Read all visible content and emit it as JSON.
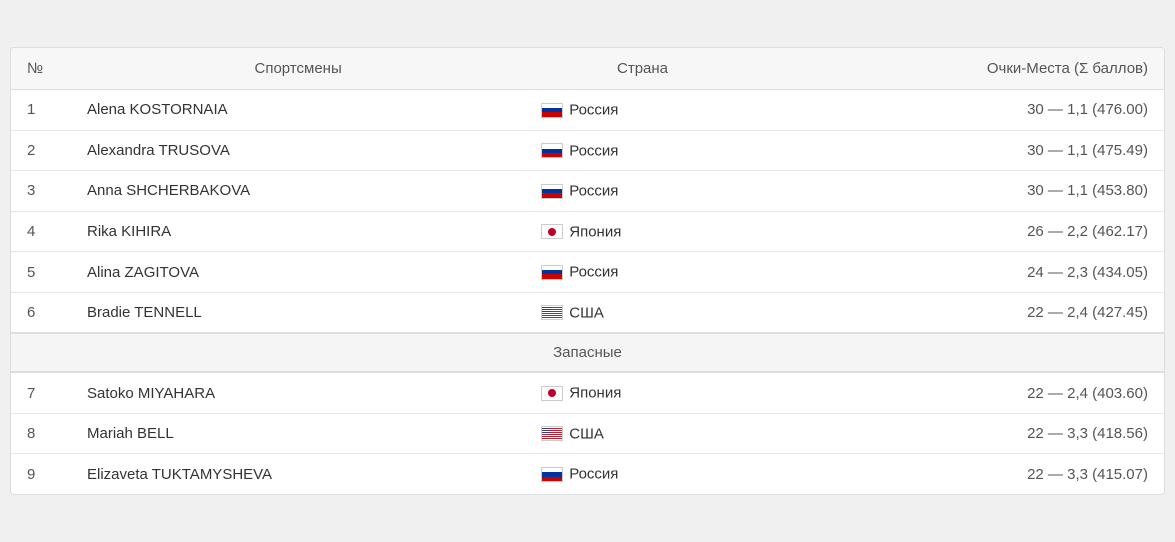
{
  "header": {
    "col_num": "№",
    "col_athlete": "Спортсмены",
    "col_country": "Страна",
    "col_score": "Очки-Места (Σ баллов)"
  },
  "reserve_label": "Запасные",
  "rows": [
    {
      "num": "1",
      "athlete": "Alena KOSTORNAIA",
      "country_name": "Россия",
      "country_flag": "russia",
      "score": "30 — 1,1 (476.00)"
    },
    {
      "num": "2",
      "athlete": "Alexandra TRUSOVA",
      "country_name": "Россия",
      "country_flag": "russia",
      "score": "30 — 1,1 (475.49)"
    },
    {
      "num": "3",
      "athlete": "Anna SHCHERBAKOVA",
      "country_name": "Россия",
      "country_flag": "russia",
      "score": "30 — 1,1 (453.80)"
    },
    {
      "num": "4",
      "athlete": "Rika KIHIRA",
      "country_name": "Япония",
      "country_flag": "japan",
      "score": "26 — 2,2 (462.17)"
    },
    {
      "num": "5",
      "athlete": "Alina ZAGITOVA",
      "country_name": "Россия",
      "country_flag": "russia",
      "score": "24 — 2,3 (434.05)"
    },
    {
      "num": "6",
      "athlete": "Bradie TENNELL",
      "country_name": "США",
      "country_flag": "usa",
      "score": "22 — 2,4 (427.45)"
    },
    {
      "num": "7",
      "athlete": "Satoko MIYAHARA",
      "country_name": "Япония",
      "country_flag": "japan",
      "score": "22 — 2,4 (403.60)"
    },
    {
      "num": "8",
      "athlete": "Mariah BELL",
      "country_name": "США",
      "country_flag": "usa",
      "score": "22 — 3,3 (418.56)"
    },
    {
      "num": "9",
      "athlete": "Elizaveta TUKTAMYSHEVA",
      "country_name": "Россия",
      "country_flag": "russia",
      "score": "22 — 3,3 (415.07)"
    }
  ]
}
